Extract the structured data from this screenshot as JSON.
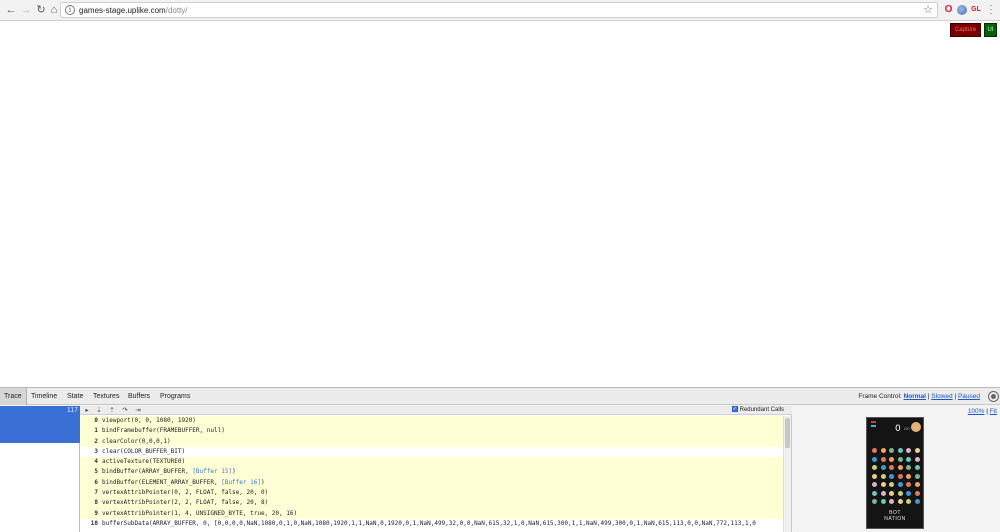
{
  "browser": {
    "url_host": "games-stage.uplike.com",
    "url_path": "/dotty/",
    "extensions": [
      "opera-icon",
      "globe-icon",
      "gl-icon"
    ],
    "ext_gl_label": "GL"
  },
  "overlay": {
    "capture_label": "Capture",
    "ui_label": "UI"
  },
  "inspector": {
    "tabs": [
      "Trace",
      "Timeline",
      "State",
      "Textures",
      "Buffers",
      "Programs"
    ],
    "active_tab": "Trace",
    "frame_control": {
      "label": "Frame Control:",
      "normal": "Normal",
      "slowed": "Slowed",
      "paused": "Paused",
      "separator": "|"
    },
    "frame_count": "117",
    "redundant_calls_label": "Redundant Calls",
    "zoom": {
      "percent": "100%",
      "fit": "Fit",
      "separator": "|"
    },
    "calls": [
      {
        "idx": "0",
        "text": "viewport(0, 0, 1080, 1920)",
        "highlight": true
      },
      {
        "idx": "1",
        "text": "bindFramebuffer(FRAMEBUFFER, null)",
        "highlight": true
      },
      {
        "idx": "2",
        "text": "clearColor(0,0,0,1)",
        "highlight": true
      },
      {
        "idx": "3",
        "text": "clear(COLOR_BUFFER_BIT)",
        "highlight": false
      },
      {
        "idx": "4",
        "text": "activeTexture(TEXTURE0)",
        "highlight": true
      },
      {
        "idx": "5",
        "pre": "bindBuffer(ARRAY_BUFFER, ",
        "ref": "[Buffer 15]",
        "post": ")",
        "highlight": true
      },
      {
        "idx": "6",
        "pre": "bindBuffer(ELEMENT_ARRAY_BUFFER, ",
        "ref": "[Buffer 16]",
        "post": ")",
        "highlight": true
      },
      {
        "idx": "7",
        "text": "vertexAttribPointer(0, 2, FLOAT, false, 20, 0)",
        "highlight": true
      },
      {
        "idx": "8",
        "text": "vertexAttribPointer(2, 2, FLOAT, false, 20, 8)",
        "highlight": true
      },
      {
        "idx": "9",
        "text": "vertexAttribPointer(1, 4, UNSIGNED_BYTE, true, 20, 16)",
        "highlight": true
      },
      {
        "idx": "10",
        "text": "bufferSubData(ARRAY_BUFFER, 0, [0,0,0,0,NaN,1080,0,1,0,NaN,1080,1920,1,1,NaN,0,1920,0,1,NaN,499,32,0,0,NaN,615,32,1,0,NaN,615,300,1,1,NaN,499,300,0,1,NaN,615,113,0,0,NaN,772,113,1,0",
        "highlight": false
      }
    ],
    "game_preview": {
      "score": "0",
      "score_sub": "/20",
      "title_line1": "BOT",
      "title_line2": "NATION"
    }
  }
}
